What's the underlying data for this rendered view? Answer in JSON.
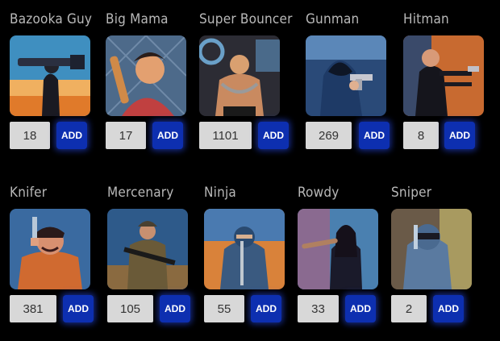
{
  "characters": [
    {
      "name": "Bazooka Guy",
      "quantity": "18",
      "add_label": "ADD",
      "icon": "bazooka-guy-portrait"
    },
    {
      "name": "Big Mama",
      "quantity": "17",
      "add_label": "ADD",
      "icon": "big-mama-portrait"
    },
    {
      "name": "Super Bouncer",
      "quantity": "1101",
      "add_label": "ADD",
      "icon": "super-bouncer-portrait"
    },
    {
      "name": "Gunman",
      "quantity": "269",
      "add_label": "ADD",
      "icon": "gunman-portrait"
    },
    {
      "name": "Hitman",
      "quantity": "8",
      "add_label": "ADD",
      "icon": "hitman-portrait"
    },
    {
      "name": "Knifer",
      "quantity": "381",
      "add_label": "ADD",
      "icon": "knifer-portrait"
    },
    {
      "name": "Mercenary",
      "quantity": "105",
      "add_label": "ADD",
      "icon": "mercenary-portrait"
    },
    {
      "name": "Ninja",
      "quantity": "55",
      "add_label": "ADD",
      "icon": "ninja-portrait"
    },
    {
      "name": "Rowdy",
      "quantity": "33",
      "add_label": "ADD",
      "icon": "rowdy-portrait"
    },
    {
      "name": "Sniper",
      "quantity": "2",
      "add_label": "ADD",
      "icon": "sniper-portrait"
    }
  ],
  "colors": {
    "background": "#000000",
    "label_text": "#b8b8b8",
    "quantity_field": "#d8d8d8",
    "add_button": "#0d2fb0"
  }
}
